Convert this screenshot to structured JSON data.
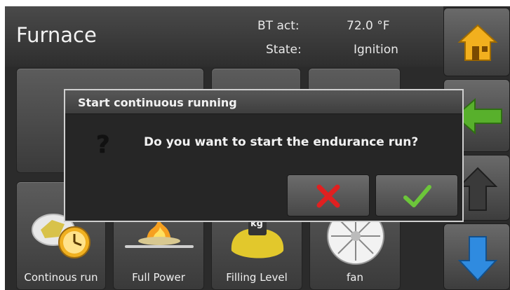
{
  "header": {
    "title": "Furnace",
    "bt_label": "BT act:",
    "bt_value": "72.0 °F",
    "state_label": "State:",
    "state_value": "Ignition"
  },
  "tiles": [
    {
      "label": "Continous run",
      "icon": "clock-pellet-icon"
    },
    {
      "label": "Full Power",
      "icon": "fire-tray-icon"
    },
    {
      "label": "Filling Level",
      "icon": "weight-pellet-pile-icon",
      "weight_text": "kg"
    },
    {
      "label": "fan",
      "icon": "fan-icon"
    }
  ],
  "sidebar": {
    "home_icon": "home-icon",
    "back_icon": "back-arrow-icon",
    "up_icon": "up-arrow-icon",
    "down_icon": "down-arrow-icon"
  },
  "dialog": {
    "title": "Start continuous running",
    "question_mark": "?",
    "message": "Do you want to start the endurance run?",
    "cancel_icon": "cross-icon",
    "confirm_icon": "check-icon"
  },
  "colors": {
    "home_yellow": "#f2b01e",
    "green_arrow": "#58b02c",
    "blue_arrow": "#2f8be0",
    "cancel_red": "#e02020",
    "confirm_green": "#6cc63a"
  }
}
